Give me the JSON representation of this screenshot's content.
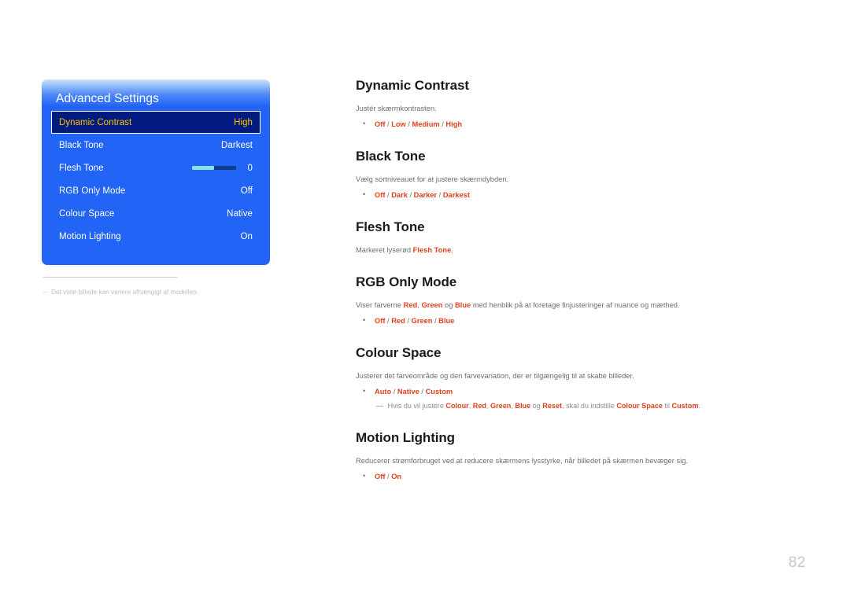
{
  "osd": {
    "title": "Advanced Settings",
    "rows": [
      {
        "label": "Dynamic Contrast",
        "value": "High",
        "selected": true,
        "type": "text"
      },
      {
        "label": "Black Tone",
        "value": "Darkest",
        "selected": false,
        "type": "text"
      },
      {
        "label": "Flesh Tone",
        "value": "0",
        "selected": false,
        "type": "slider",
        "slider_percent": 50
      },
      {
        "label": "RGB Only Mode",
        "value": "Off",
        "selected": false,
        "type": "text"
      },
      {
        "label": "Colour Space",
        "value": "Native",
        "selected": false,
        "type": "text"
      },
      {
        "label": "Motion Lighting",
        "value": "On",
        "selected": false,
        "type": "text"
      }
    ],
    "colors": {
      "panel_blue": "#2264f5",
      "selected_bg": "#001a7d",
      "selected_text": "#ffc400",
      "slider_fill": "#86e4e6",
      "slider_track": "#0d3f8a"
    }
  },
  "figure_note": {
    "dash": "–",
    "text": "Det viste billede kan variere afhængigt af modellen."
  },
  "sections": [
    {
      "title": "Dynamic Contrast",
      "desc": "Justér skærmkontrasten.",
      "options_html": "<span class=\"kw\">Off</span><span class=\"sep\"> / </span><span class=\"kw\">Low</span><span class=\"sep\"> / </span><span class=\"kw\">Medium</span><span class=\"sep\"> / </span><span class=\"kw\">High</span>",
      "options_plain": "Off / Low / Medium / High"
    },
    {
      "title": "Black Tone",
      "desc": "Vælg sortniveauet for at justere skærmdybden.",
      "options_html": "<span class=\"kw\">Off</span><span class=\"sep\"> / </span><span class=\"kw\">Dark</span><span class=\"sep\"> / </span><span class=\"kw\">Darker</span><span class=\"sep\"> / </span><span class=\"kw\">Darkest</span>",
      "options_plain": "Off / Dark / Darker / Darkest"
    },
    {
      "title": "Flesh Tone",
      "desc_html": "Markeret lyserød <span class=\"kw\">Flesh Tone</span>.",
      "desc": "Markeret lyserød Flesh Tone.",
      "options_html": "",
      "options_plain": ""
    },
    {
      "title": "RGB Only Mode",
      "desc_html": "Viser farverne <span class=\"kw\">Red</span>, <span class=\"kw\">Green</span> og <span class=\"kw\">Blue</span> med henblik på at foretage finjusteringer af nuance og mæthed.",
      "desc": "Viser farverne Red, Green og Blue med henblik på at foretage finjusteringer af nuance og mæthed.",
      "options_html": "<span class=\"kw\">Off</span><span class=\"sep\"> / </span><span class=\"kw\">Red</span><span class=\"sep\"> / </span><span class=\"kw\">Green</span><span class=\"sep\"> / </span><span class=\"kw\">Blue</span>",
      "options_plain": "Off / Red / Green / Blue"
    },
    {
      "title": "Colour Space",
      "desc": "Justerer det farveområde og den farvevariation, der er tilgængelig til at skabe billeder.",
      "options_html": "<span class=\"kw\">Auto</span><span class=\"sep\"> / </span><span class=\"kw\">Native</span><span class=\"sep\"> / </span><span class=\"kw\">Custom</span>",
      "options_plain": "Auto / Native / Custom",
      "subnote_html": "<span class=\"dash\">—</span> Hvis du vil justere <span class=\"kw\">Colour</span>, <span class=\"kw\">Red</span>, <span class=\"kw\">Green</span>, <span class=\"kw\">Blue</span> og <span class=\"kw\">Reset</span>, skal du indstille <span class=\"kw\">Colour Space</span> til <span class=\"kw\">Custom</span>.",
      "subnote": "— Hvis du vil justere Colour, Red, Green, Blue og Reset, skal du indstille Colour Space til Custom."
    },
    {
      "title": "Motion Lighting",
      "desc": "Reducerer strømforbruget ved at reducere skærmens lysstyrke, når billedet på skærmen bevæger sig.",
      "options_html": "<span class=\"kw\">Off</span><span class=\"sep\"> / </span><span class=\"kw\">On</span>",
      "options_plain": "Off / On"
    }
  ],
  "page_number": "82"
}
